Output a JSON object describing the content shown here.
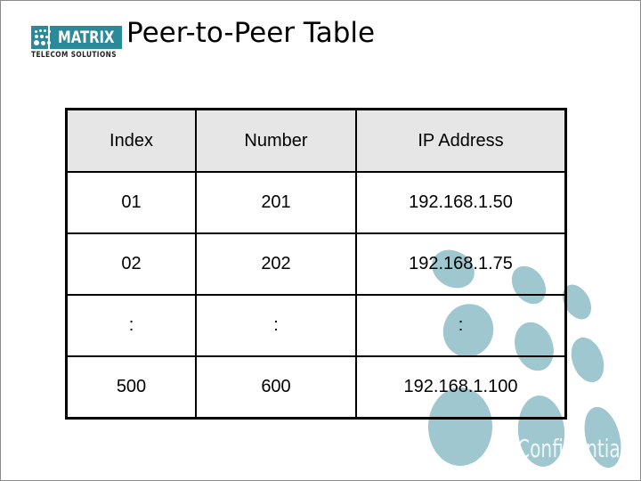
{
  "logo": {
    "brand": "MATRIX",
    "tagline": "TELECOM SOLUTIONS",
    "color": "#2a8a9a"
  },
  "title": "Peer-to-Peer Table",
  "table": {
    "headers": [
      "Index",
      "Number",
      "IP Address"
    ],
    "rows": [
      [
        "01",
        "201",
        "192.168.1.50"
      ],
      [
        "02",
        "202",
        "192.168.1.75"
      ],
      [
        ":",
        ":",
        ":"
      ],
      [
        "500",
        "600",
        "192.168.1.100"
      ]
    ]
  },
  "watermark": {
    "text": "Confidential",
    "dot_color": "#9ec7d0"
  }
}
